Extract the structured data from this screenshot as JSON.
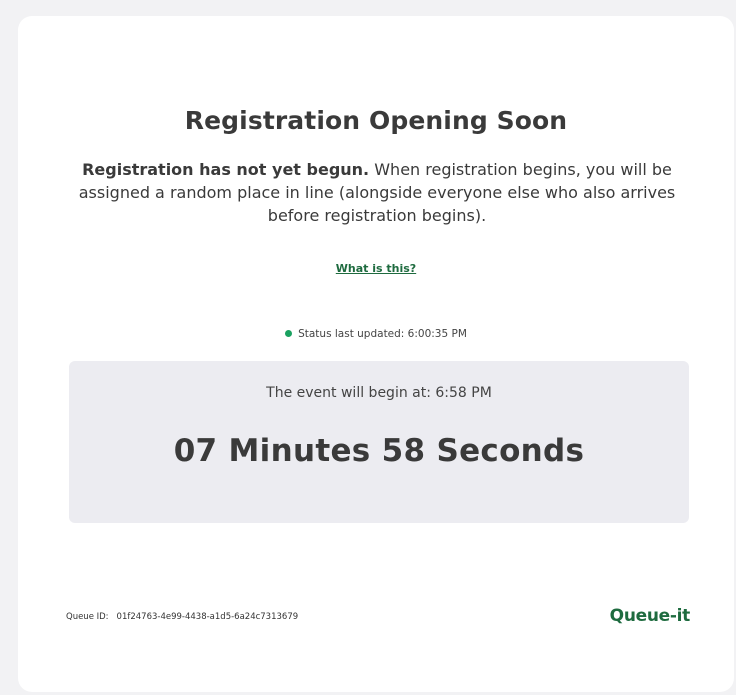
{
  "page": {
    "title": "Registration Opening Soon",
    "description_bold": "Registration has not yet begun.",
    "description_rest": " When registration begins, you will be assigned a random place in line (alongside everyone else who also arrives before registration begins).",
    "help_link": "What is this?"
  },
  "status": {
    "label": "Status last updated: 6:00:35 PM",
    "dot_color": "#1aa160"
  },
  "countdown": {
    "begin_label": "The event will begin at: 6:58 PM",
    "remaining": "07 Minutes 58 Seconds"
  },
  "footer": {
    "queue_id_label": "Queue ID:",
    "queue_id_value": "01f24763-4e99-4438-a1d5-6a24c7313679",
    "logo_text": "Queue-it"
  },
  "colors": {
    "brand_green": "#1e6b3f",
    "panel_bg": "#ececf1"
  }
}
